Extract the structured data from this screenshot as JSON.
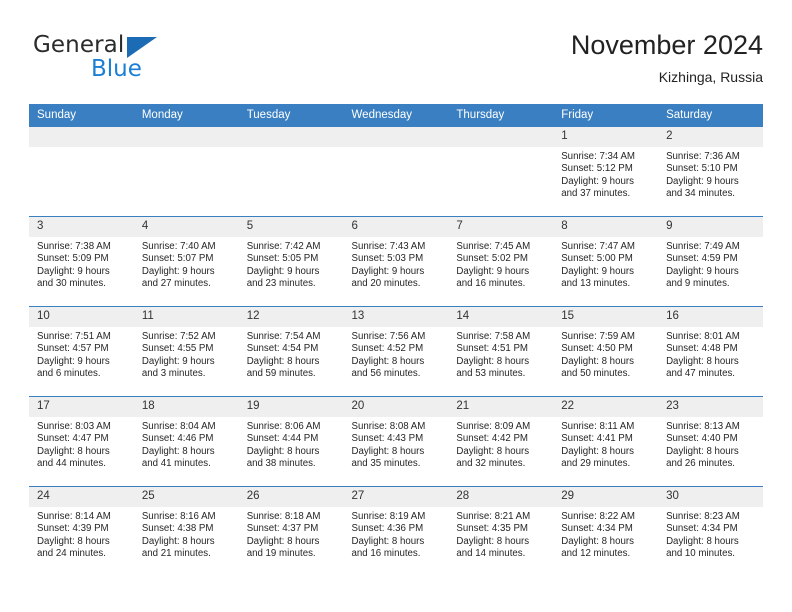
{
  "brand": {
    "name_part1": "General",
    "name_part2": "Blue",
    "accent_color": "#1b7fd4",
    "triangle_color": "#1b6cb5"
  },
  "header": {
    "title": "November 2024",
    "subtitle": "Kizhinga, Russia"
  },
  "theme": {
    "header_bg": "#3a7fc1",
    "daynum_bg": "#efefef",
    "cell_bg": "#ffffff",
    "text": "#262626"
  },
  "weekdays": [
    "Sunday",
    "Monday",
    "Tuesday",
    "Wednesday",
    "Thursday",
    "Friday",
    "Saturday"
  ],
  "weeks": [
    [
      {
        "day": "",
        "blank": true,
        "sunrise": "",
        "sunset": "",
        "daylight1": "",
        "daylight2": ""
      },
      {
        "day": "",
        "blank": true,
        "sunrise": "",
        "sunset": "",
        "daylight1": "",
        "daylight2": ""
      },
      {
        "day": "",
        "blank": true,
        "sunrise": "",
        "sunset": "",
        "daylight1": "",
        "daylight2": ""
      },
      {
        "day": "",
        "blank": true,
        "sunrise": "",
        "sunset": "",
        "daylight1": "",
        "daylight2": ""
      },
      {
        "day": "",
        "blank": true,
        "sunrise": "",
        "sunset": "",
        "daylight1": "",
        "daylight2": ""
      },
      {
        "day": "1",
        "blank": false,
        "sunrise": "Sunrise: 7:34 AM",
        "sunset": "Sunset: 5:12 PM",
        "daylight1": "Daylight: 9 hours",
        "daylight2": "and 37 minutes."
      },
      {
        "day": "2",
        "blank": false,
        "sunrise": "Sunrise: 7:36 AM",
        "sunset": "Sunset: 5:10 PM",
        "daylight1": "Daylight: 9 hours",
        "daylight2": "and 34 minutes."
      }
    ],
    [
      {
        "day": "3",
        "blank": false,
        "sunrise": "Sunrise: 7:38 AM",
        "sunset": "Sunset: 5:09 PM",
        "daylight1": "Daylight: 9 hours",
        "daylight2": "and 30 minutes."
      },
      {
        "day": "4",
        "blank": false,
        "sunrise": "Sunrise: 7:40 AM",
        "sunset": "Sunset: 5:07 PM",
        "daylight1": "Daylight: 9 hours",
        "daylight2": "and 27 minutes."
      },
      {
        "day": "5",
        "blank": false,
        "sunrise": "Sunrise: 7:42 AM",
        "sunset": "Sunset: 5:05 PM",
        "daylight1": "Daylight: 9 hours",
        "daylight2": "and 23 minutes."
      },
      {
        "day": "6",
        "blank": false,
        "sunrise": "Sunrise: 7:43 AM",
        "sunset": "Sunset: 5:03 PM",
        "daylight1": "Daylight: 9 hours",
        "daylight2": "and 20 minutes."
      },
      {
        "day": "7",
        "blank": false,
        "sunrise": "Sunrise: 7:45 AM",
        "sunset": "Sunset: 5:02 PM",
        "daylight1": "Daylight: 9 hours",
        "daylight2": "and 16 minutes."
      },
      {
        "day": "8",
        "blank": false,
        "sunrise": "Sunrise: 7:47 AM",
        "sunset": "Sunset: 5:00 PM",
        "daylight1": "Daylight: 9 hours",
        "daylight2": "and 13 minutes."
      },
      {
        "day": "9",
        "blank": false,
        "sunrise": "Sunrise: 7:49 AM",
        "sunset": "Sunset: 4:59 PM",
        "daylight1": "Daylight: 9 hours",
        "daylight2": "and 9 minutes."
      }
    ],
    [
      {
        "day": "10",
        "blank": false,
        "sunrise": "Sunrise: 7:51 AM",
        "sunset": "Sunset: 4:57 PM",
        "daylight1": "Daylight: 9 hours",
        "daylight2": "and 6 minutes."
      },
      {
        "day": "11",
        "blank": false,
        "sunrise": "Sunrise: 7:52 AM",
        "sunset": "Sunset: 4:55 PM",
        "daylight1": "Daylight: 9 hours",
        "daylight2": "and 3 minutes."
      },
      {
        "day": "12",
        "blank": false,
        "sunrise": "Sunrise: 7:54 AM",
        "sunset": "Sunset: 4:54 PM",
        "daylight1": "Daylight: 8 hours",
        "daylight2": "and 59 minutes."
      },
      {
        "day": "13",
        "blank": false,
        "sunrise": "Sunrise: 7:56 AM",
        "sunset": "Sunset: 4:52 PM",
        "daylight1": "Daylight: 8 hours",
        "daylight2": "and 56 minutes."
      },
      {
        "day": "14",
        "blank": false,
        "sunrise": "Sunrise: 7:58 AM",
        "sunset": "Sunset: 4:51 PM",
        "daylight1": "Daylight: 8 hours",
        "daylight2": "and 53 minutes."
      },
      {
        "day": "15",
        "blank": false,
        "sunrise": "Sunrise: 7:59 AM",
        "sunset": "Sunset: 4:50 PM",
        "daylight1": "Daylight: 8 hours",
        "daylight2": "and 50 minutes."
      },
      {
        "day": "16",
        "blank": false,
        "sunrise": "Sunrise: 8:01 AM",
        "sunset": "Sunset: 4:48 PM",
        "daylight1": "Daylight: 8 hours",
        "daylight2": "and 47 minutes."
      }
    ],
    [
      {
        "day": "17",
        "blank": false,
        "sunrise": "Sunrise: 8:03 AM",
        "sunset": "Sunset: 4:47 PM",
        "daylight1": "Daylight: 8 hours",
        "daylight2": "and 44 minutes."
      },
      {
        "day": "18",
        "blank": false,
        "sunrise": "Sunrise: 8:04 AM",
        "sunset": "Sunset: 4:46 PM",
        "daylight1": "Daylight: 8 hours",
        "daylight2": "and 41 minutes."
      },
      {
        "day": "19",
        "blank": false,
        "sunrise": "Sunrise: 8:06 AM",
        "sunset": "Sunset: 4:44 PM",
        "daylight1": "Daylight: 8 hours",
        "daylight2": "and 38 minutes."
      },
      {
        "day": "20",
        "blank": false,
        "sunrise": "Sunrise: 8:08 AM",
        "sunset": "Sunset: 4:43 PM",
        "daylight1": "Daylight: 8 hours",
        "daylight2": "and 35 minutes."
      },
      {
        "day": "21",
        "blank": false,
        "sunrise": "Sunrise: 8:09 AM",
        "sunset": "Sunset: 4:42 PM",
        "daylight1": "Daylight: 8 hours",
        "daylight2": "and 32 minutes."
      },
      {
        "day": "22",
        "blank": false,
        "sunrise": "Sunrise: 8:11 AM",
        "sunset": "Sunset: 4:41 PM",
        "daylight1": "Daylight: 8 hours",
        "daylight2": "and 29 minutes."
      },
      {
        "day": "23",
        "blank": false,
        "sunrise": "Sunrise: 8:13 AM",
        "sunset": "Sunset: 4:40 PM",
        "daylight1": "Daylight: 8 hours",
        "daylight2": "and 26 minutes."
      }
    ],
    [
      {
        "day": "24",
        "blank": false,
        "sunrise": "Sunrise: 8:14 AM",
        "sunset": "Sunset: 4:39 PM",
        "daylight1": "Daylight: 8 hours",
        "daylight2": "and 24 minutes."
      },
      {
        "day": "25",
        "blank": false,
        "sunrise": "Sunrise: 8:16 AM",
        "sunset": "Sunset: 4:38 PM",
        "daylight1": "Daylight: 8 hours",
        "daylight2": "and 21 minutes."
      },
      {
        "day": "26",
        "blank": false,
        "sunrise": "Sunrise: 8:18 AM",
        "sunset": "Sunset: 4:37 PM",
        "daylight1": "Daylight: 8 hours",
        "daylight2": "and 19 minutes."
      },
      {
        "day": "27",
        "blank": false,
        "sunrise": "Sunrise: 8:19 AM",
        "sunset": "Sunset: 4:36 PM",
        "daylight1": "Daylight: 8 hours",
        "daylight2": "and 16 minutes."
      },
      {
        "day": "28",
        "blank": false,
        "sunrise": "Sunrise: 8:21 AM",
        "sunset": "Sunset: 4:35 PM",
        "daylight1": "Daylight: 8 hours",
        "daylight2": "and 14 minutes."
      },
      {
        "day": "29",
        "blank": false,
        "sunrise": "Sunrise: 8:22 AM",
        "sunset": "Sunset: 4:34 PM",
        "daylight1": "Daylight: 8 hours",
        "daylight2": "and 12 minutes."
      },
      {
        "day": "30",
        "blank": false,
        "sunrise": "Sunrise: 8:23 AM",
        "sunset": "Sunset: 4:34 PM",
        "daylight1": "Daylight: 8 hours",
        "daylight2": "and 10 minutes."
      }
    ]
  ]
}
